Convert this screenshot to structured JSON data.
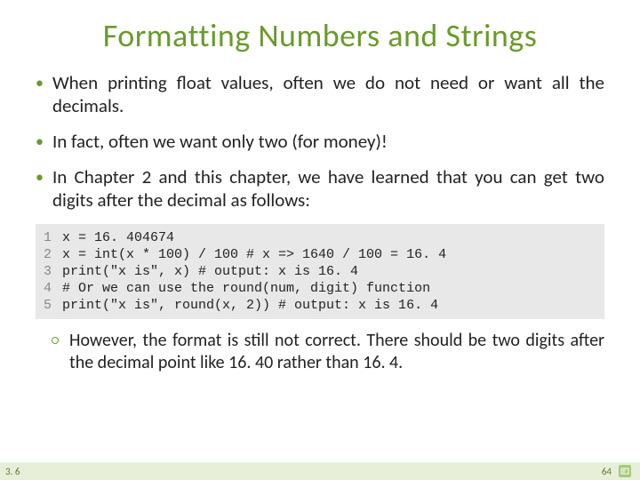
{
  "title": "Formatting Numbers and Strings",
  "bullets": [
    "When printing float values, often we do not need or want all the decimals.",
    "In fact, often we want only two (for money)!",
    "In Chapter 2 and this chapter, we have learned that you can get two digits after the decimal as follows:"
  ],
  "code": {
    "lines": [
      {
        "n": "1",
        "t": "x = 16. 404674"
      },
      {
        "n": "2",
        "t": "x = int(x * 100) / 100 # x => 1640 / 100 = 16. 4"
      },
      {
        "n": "3",
        "t": "print(\"x is\", x) # output: x is 16. 4"
      },
      {
        "n": "4",
        "t": "# Or we can use the round(num, digit) function"
      },
      {
        "n": "5",
        "t": "print(\"x is\", round(x, 2)) # output: x is 16. 4"
      }
    ]
  },
  "sub": "However, the format is still not correct. There should be two digits after the decimal point like 16. 40 rather than 16. 4.",
  "footer": {
    "section": "3. 6",
    "page": "64"
  }
}
